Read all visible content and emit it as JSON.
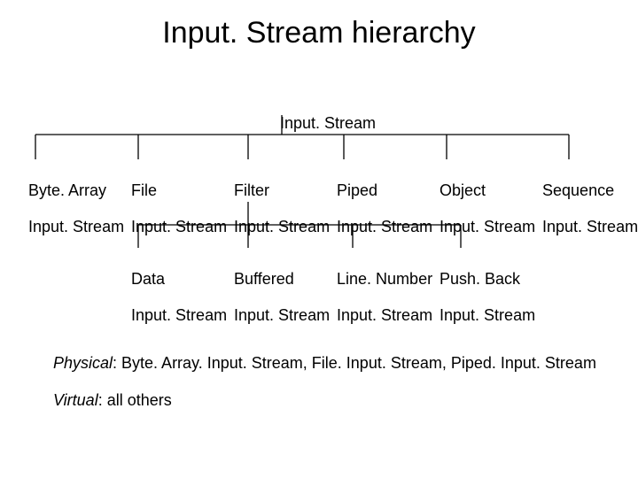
{
  "title": "Input. Stream hierarchy",
  "root": "Input. Stream",
  "level1": [
    {
      "top": "Byte. Array",
      "bottom": "Input. Stream"
    },
    {
      "top": "File",
      "bottom": "Input. Stream"
    },
    {
      "top": "Filter",
      "bottom": "Input. Stream"
    },
    {
      "top": "Piped",
      "bottom": "Input. Stream"
    },
    {
      "top": "Object",
      "bottom": "Input. Stream"
    },
    {
      "top": "Sequence",
      "bottom": "Input. Stream"
    }
  ],
  "level2": [
    {
      "top": "Data",
      "bottom": "Input. Stream"
    },
    {
      "top": "Buffered",
      "bottom": "Input. Stream"
    },
    {
      "top": "Line. Number",
      "bottom": "Input. Stream"
    },
    {
      "top": "Push. Back",
      "bottom": "Input. Stream"
    }
  ],
  "note_physical_label": "Physical",
  "note_physical_body": ": Byte. Array. Input. Stream, File. Input. Stream, Piped. Input. Stream",
  "note_virtual_label": "Virtual",
  "note_virtual_body": ": all others"
}
